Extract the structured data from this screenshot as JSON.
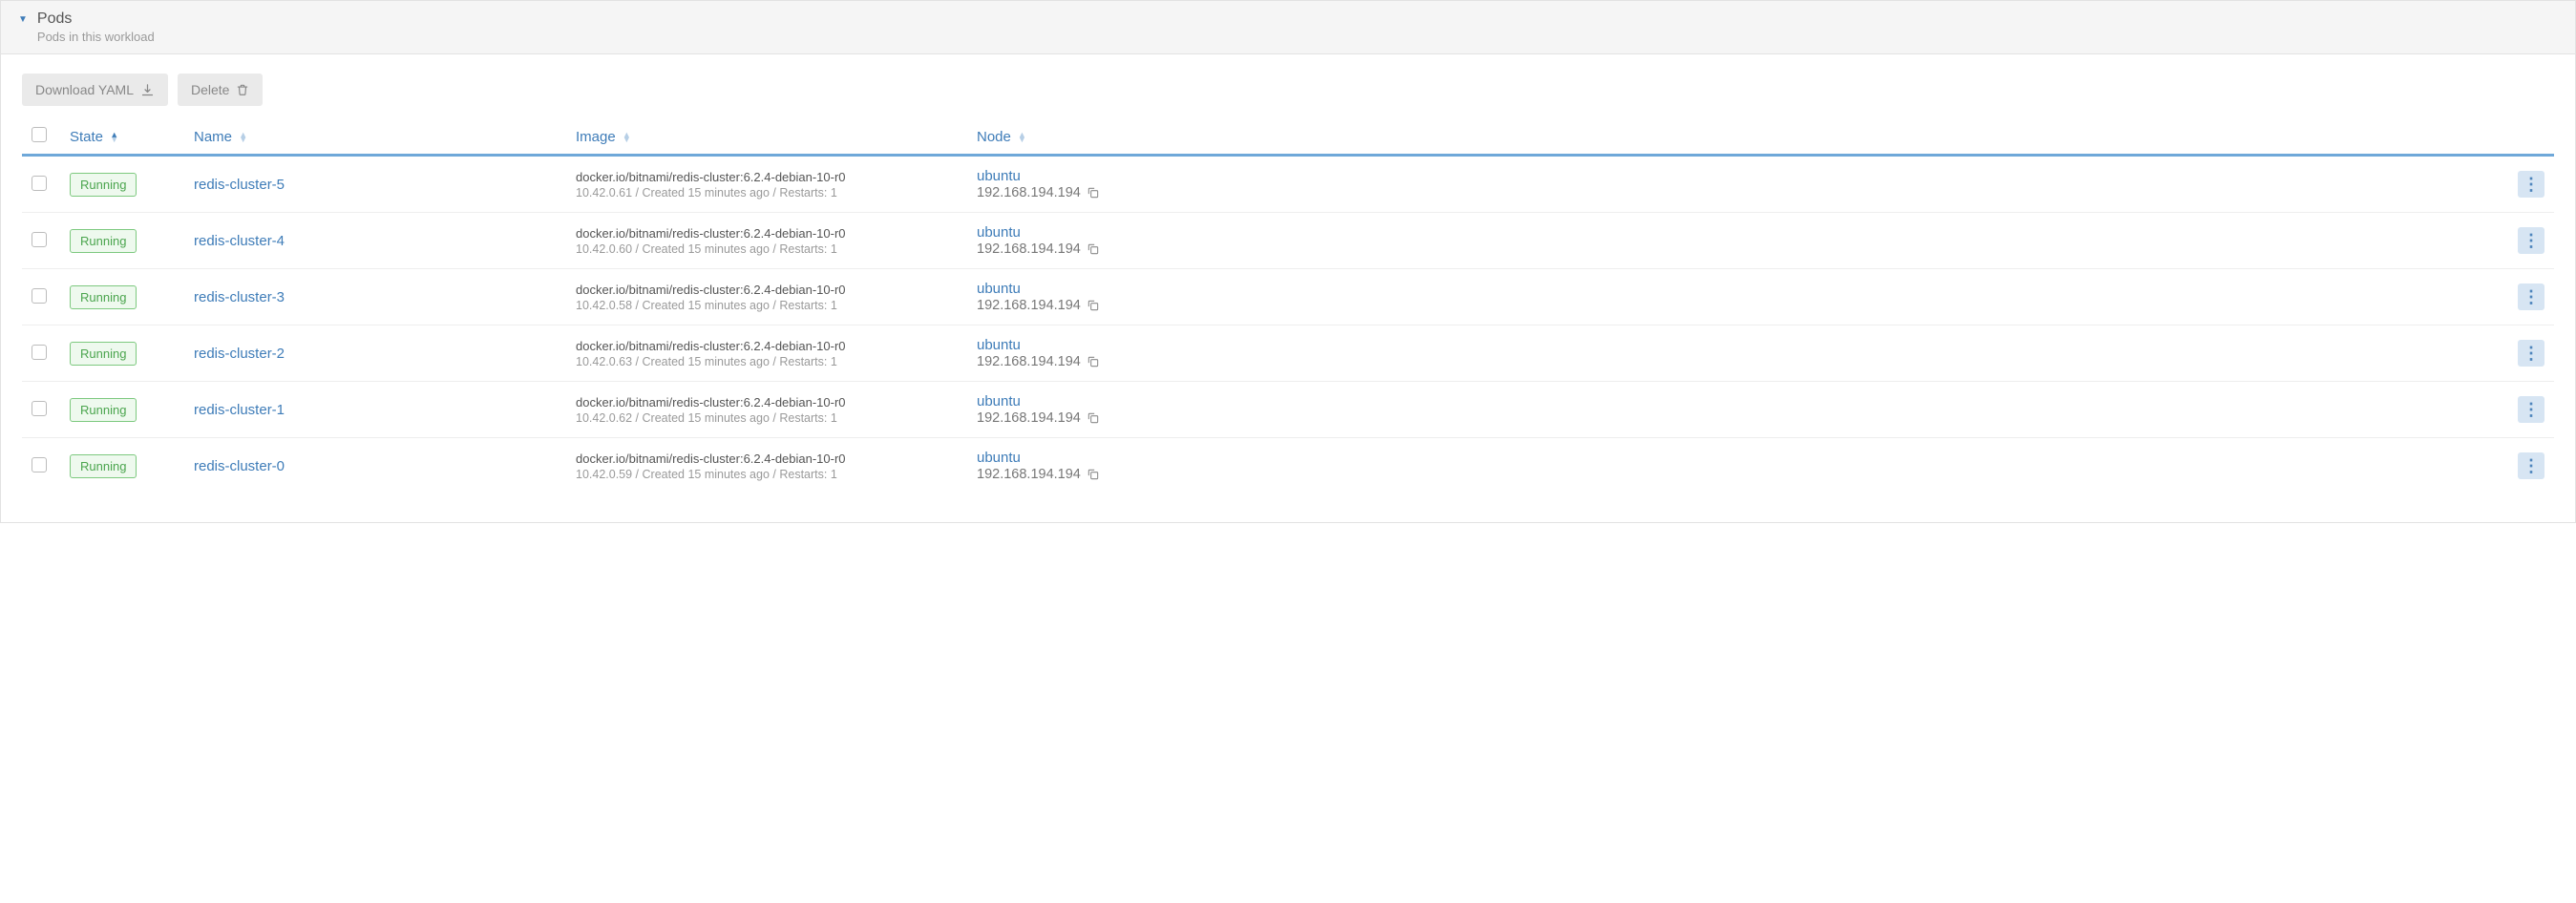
{
  "header": {
    "title": "Pods",
    "subtitle": "Pods in this workload"
  },
  "toolbar": {
    "download_label": "Download YAML",
    "delete_label": "Delete"
  },
  "columns": {
    "state": "State",
    "name": "Name",
    "image": "Image",
    "node": "Node"
  },
  "rows": [
    {
      "state": "Running",
      "name": "redis-cluster-5",
      "image": "docker.io/bitnami/redis-cluster:6.2.4-debian-10-r0",
      "meta": "10.42.0.61 / Created 15 minutes ago / Restarts: 1",
      "node_name": "ubuntu",
      "node_ip": "192.168.194.194"
    },
    {
      "state": "Running",
      "name": "redis-cluster-4",
      "image": "docker.io/bitnami/redis-cluster:6.2.4-debian-10-r0",
      "meta": "10.42.0.60 / Created 15 minutes ago / Restarts: 1",
      "node_name": "ubuntu",
      "node_ip": "192.168.194.194"
    },
    {
      "state": "Running",
      "name": "redis-cluster-3",
      "image": "docker.io/bitnami/redis-cluster:6.2.4-debian-10-r0",
      "meta": "10.42.0.58 / Created 15 minutes ago / Restarts: 1",
      "node_name": "ubuntu",
      "node_ip": "192.168.194.194"
    },
    {
      "state": "Running",
      "name": "redis-cluster-2",
      "image": "docker.io/bitnami/redis-cluster:6.2.4-debian-10-r0",
      "meta": "10.42.0.63 / Created 15 minutes ago / Restarts: 1",
      "node_name": "ubuntu",
      "node_ip": "192.168.194.194"
    },
    {
      "state": "Running",
      "name": "redis-cluster-1",
      "image": "docker.io/bitnami/redis-cluster:6.2.4-debian-10-r0",
      "meta": "10.42.0.62 / Created 15 minutes ago / Restarts: 1",
      "node_name": "ubuntu",
      "node_ip": "192.168.194.194"
    },
    {
      "state": "Running",
      "name": "redis-cluster-0",
      "image": "docker.io/bitnami/redis-cluster:6.2.4-debian-10-r0",
      "meta": "10.42.0.59 / Created 15 minutes ago / Restarts: 1",
      "node_name": "ubuntu",
      "node_ip": "192.168.194.194"
    }
  ]
}
